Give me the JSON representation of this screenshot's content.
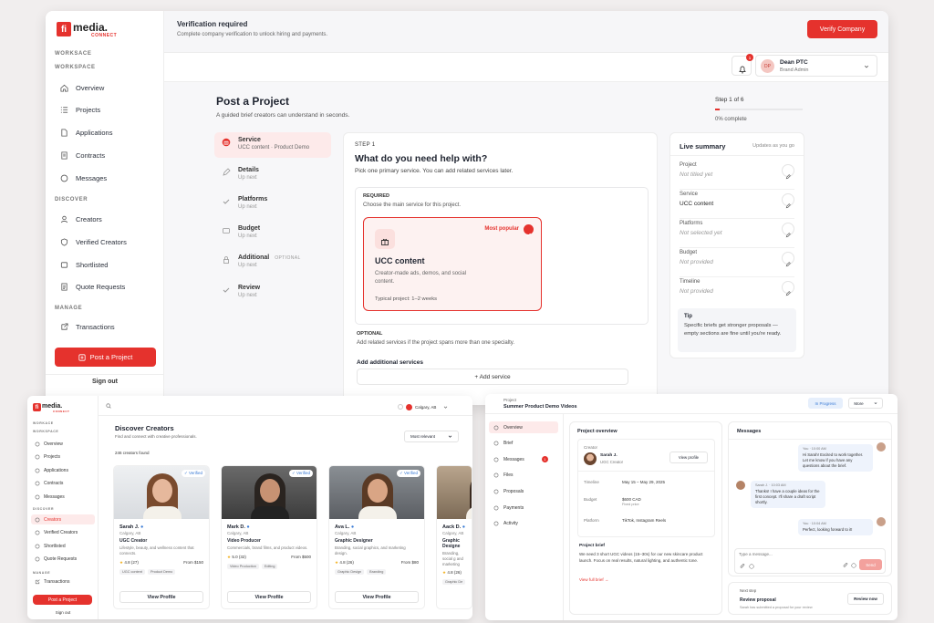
{
  "brand": {
    "logo_mark": "fi",
    "logo_text": "media.",
    "logo_sub": "CONNECT"
  },
  "main": {
    "sidebar": {
      "section_workspace_a": "WORKSACE",
      "section_workspace": "WORKSPACE",
      "workspace_items": [
        {
          "label": "Overview",
          "icon": "home-icon"
        },
        {
          "label": "Projects",
          "icon": "list-icon"
        },
        {
          "label": "Applications",
          "icon": "file-icon"
        },
        {
          "label": "Contracts",
          "icon": "document-icon"
        },
        {
          "label": "Messages",
          "icon": "chat-icon"
        }
      ],
      "section_discover": "DISCOVER",
      "discover_items": [
        {
          "label": "Creators",
          "icon": "user-icon"
        },
        {
          "label": "Verified Creators",
          "icon": "shield-icon"
        },
        {
          "label": "Shortlisted",
          "icon": "bookmark-icon"
        },
        {
          "label": "Quote Requests",
          "icon": "receipt-icon"
        }
      ],
      "section_manage": "MANAGE",
      "manage_items": [
        {
          "label": "Transactions",
          "icon": "external-icon"
        }
      ],
      "post_button": "Post a Project",
      "sign_out": "Sign out"
    },
    "banner": {
      "title": "Verification required",
      "text": "Complete company verification to unlock hiring and payments.",
      "button": "Verify Company"
    },
    "user": {
      "initials": "DP",
      "name": "Dean PTC",
      "role": "Brand Admin",
      "notif_count": "1"
    },
    "page": {
      "title": "Post a Project",
      "subtitle": "A guided brief creators can understand in seconds.",
      "step_label": "Step 1 of 6",
      "progress_text": "0% complete",
      "progress": 0.05
    },
    "steps": [
      {
        "title": "Service",
        "sub": "UCC content · Product Demo",
        "icon": "gift-icon",
        "active": true
      },
      {
        "title": "Details",
        "sub": "Up next",
        "icon": "pen-icon"
      },
      {
        "title": "Platforms",
        "sub": "Up next",
        "icon": "check-icon"
      },
      {
        "title": "Budget",
        "sub": "Up next",
        "icon": "wallet-icon"
      },
      {
        "title": "Additional",
        "sub": "Up next",
        "optional": "OPTIONAL",
        "icon": "lock-icon"
      },
      {
        "title": "Review",
        "sub": "Up next",
        "icon": "check-icon"
      }
    ],
    "form": {
      "step": "STEP 1",
      "title": "What do you need help with?",
      "subtitle": "Pick one primary service. You can add related services later.",
      "required_label": "REQUIRED",
      "required_text": "Choose the main service for this project.",
      "service": {
        "badge": "Most popular",
        "name": "UCC content",
        "desc": "Creator-made ads, demos, and social content.",
        "typical": "Typical project: 1–2 weeks"
      },
      "optional_label": "OPTIONAL",
      "optional_text": "Add related services if the project spans more than one specialty.",
      "add_label": "Add additional services",
      "add_button": "+ Add service"
    },
    "summary": {
      "title": "Live summary",
      "updates": "Updates as you go",
      "rows": [
        {
          "label": "Project",
          "value": "Not titled yet",
          "empty": true
        },
        {
          "label": "Service",
          "value": "UCC content",
          "empty": false
        },
        {
          "label": "Platforms",
          "value": "Not selected yet",
          "empty": true
        },
        {
          "label": "Budget",
          "value": "Not provided",
          "empty": true
        },
        {
          "label": "Timeline",
          "value": "Not provided",
          "empty": true
        }
      ],
      "tip_title": "Tip",
      "tip_text": "Specific briefs get stronger proposals — empty sections are fine until you're ready."
    }
  },
  "discover": {
    "sidebar": {
      "s1": "WORKACE",
      "s2": "WORKSPACE",
      "items1": [
        "Overview",
        "Projects",
        "Applications",
        "Contracts",
        "Messages"
      ],
      "s3": "DISCOVER",
      "items2": [
        "Creators",
        "Verified Creators",
        "Shortlisted",
        "Quote Requests"
      ],
      "s4": "MANAGE",
      "items3": [
        "Transactions"
      ],
      "post": "Post a Project",
      "signout": "Sign out"
    },
    "location": "Calgary, AB",
    "title": "Discover Creators",
    "subtitle": "Find and connect with creative professionals.",
    "count": "246 creators found",
    "sort": "Most relevant",
    "verified": "Verified",
    "view": "View Profile",
    "cards": [
      {
        "name": "Sarah J.",
        "loc": "Calgary, AB",
        "role": "UGC Creator",
        "desc": "Lifestyle, beauty, and wellness content that connects.",
        "rating": "4.8 (27)",
        "price": "From $150",
        "tags": [
          "UGC content",
          "Product Demo"
        ]
      },
      {
        "name": "Mark D.",
        "loc": "Calgary, AB",
        "role": "Video Producer",
        "desc": "Commercials, brand films, and product videos.",
        "rating": "5.0 (32)",
        "price": "From $500",
        "tags": [
          "Video Production",
          "Editing"
        ]
      },
      {
        "name": "Ava L.",
        "loc": "Calgary, AB",
        "role": "Graphic Designer",
        "desc": "Branding, social graphics, and marketing design.",
        "rating": "4.8 (26)",
        "price": "From $80",
        "tags": [
          "Graphic Design",
          "Branding"
        ]
      },
      {
        "name": "Aack D.",
        "loc": "Calgary, AB",
        "role": "Graphic Designe",
        "desc": "Branding, social g and marketing",
        "rating": "4.8 (26)",
        "price": "",
        "tags": [
          "Graphic De"
        ]
      }
    ]
  },
  "project": {
    "label": "Project",
    "title": "Summer Product Demo Videos",
    "status": "In Progress",
    "more": "More",
    "nav": [
      "Overview",
      "Brief",
      "Messages",
      "Files",
      "Proposals",
      "Payments",
      "Activity"
    ],
    "msg_badge": "1",
    "overview_title": "Project overview",
    "creator_label": "Creator",
    "creator_name": "Sarah J.",
    "creator_role": "UGC Creator",
    "view_profile": "View profile",
    "timeline_label": "Timeline",
    "timeline": "May 15 – May 29, 2025",
    "budget_label": "Budget",
    "budget": "$600 CAD",
    "budget_sub": "Fixed price",
    "platform_label": "Platform",
    "platform": "TikTok, Instagram Reels",
    "brief_label": "Project brief",
    "brief": "We need 3 short UGC videos (15–30s) for our new skincare product launch. Focus on real results, natural lighting, and authentic tone.",
    "full_brief": "View full brief →",
    "messages_title": "Messages",
    "messages": [
      {
        "who": "You",
        "time": "10:00 AM",
        "text": "Hi Sarah! Excited to work together. Let me know if you have any questions about the brief.",
        "side": "right"
      },
      {
        "who": "Sarah J.",
        "time": "10:03 AM",
        "text": "Thanks! I have a couple ideas for the first concept. I'll share a draft script shortly.",
        "side": "left"
      },
      {
        "who": "You",
        "time": "10:04 AM",
        "text": "Perfect, looking forward to it!",
        "side": "right"
      }
    ],
    "input_placeholder": "Type a message...",
    "send": "Send",
    "next_label": "Next step",
    "next_title": "Review proposal",
    "next_text": "Sarah has submitted a proposal for your review",
    "review_button": "Review now"
  },
  "colors": {
    "accent": "#e5322d",
    "verified": "#3a7bd5"
  }
}
